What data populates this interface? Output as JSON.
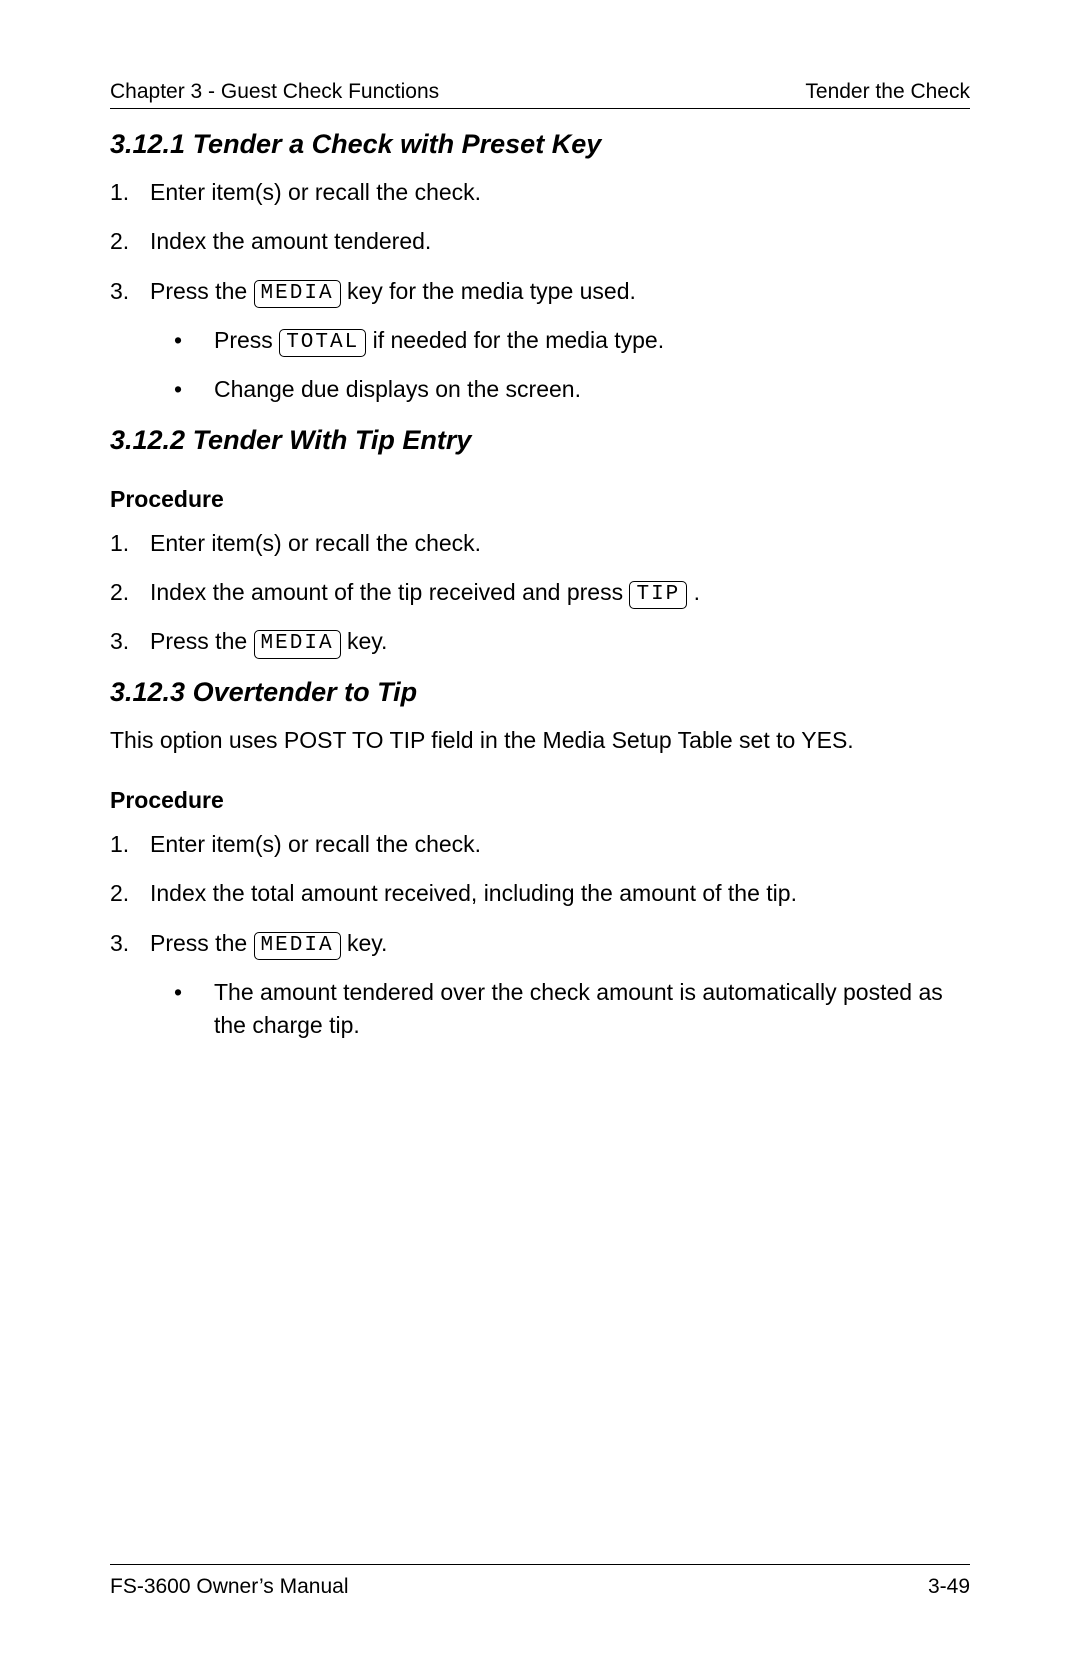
{
  "header": {
    "left": "Chapter 3 - Guest Check Functions",
    "right": "Tender the Check"
  },
  "sections": {
    "s1": {
      "title": "3.12.1  Tender a Check with Preset Key",
      "steps": {
        "n1": "Enter item(s) or recall the check.",
        "n2": "Index the amount tendered.",
        "n3_pre": "Press the ",
        "n3_key": "MEDIA",
        "n3_post": " key for the media type used.",
        "b1_pre": "Press ",
        "b1_key": "TOTAL",
        "b1_post": " if needed for the media type.",
        "b2": "Change due displays on the screen."
      }
    },
    "s2": {
      "title": "3.12.2  Tender With Tip Entry",
      "procedure_label": "Procedure",
      "steps": {
        "n1": "Enter item(s) or recall the check.",
        "n2_pre": "Index the amount of the tip received and press ",
        "n2_key": "TIP",
        "n2_post": " .",
        "n3_pre": "Press the ",
        "n3_key": "MEDIA",
        "n3_post": " key."
      }
    },
    "s3": {
      "title": "3.12.3  Overtender to Tip",
      "intro": "This option uses POST TO TIP field in the Media Setup Table set to YES.",
      "procedure_label": "Procedure",
      "steps": {
        "n1": "Enter item(s) or recall the check.",
        "n2": "Index the total amount received, including the amount of the tip.",
        "n3_pre": "Press the ",
        "n3_key": "MEDIA",
        "n3_post": " key.",
        "b1": "The amount tendered over the check amount is auto­matically posted as the charge tip."
      }
    }
  },
  "footer": {
    "left": "FS-3600 Owner’s Manual",
    "right": "3-49"
  },
  "markers": {
    "m1": "1.",
    "m2": "2.",
    "m3": "3.",
    "bullet": "•"
  }
}
